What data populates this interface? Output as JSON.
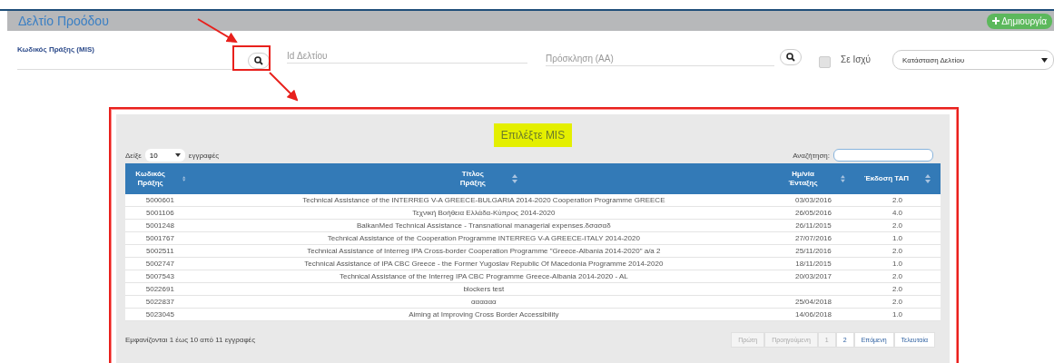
{
  "header": {
    "title": "Δελτίο Προόδου",
    "create_button": "Δημιουργία"
  },
  "filters": {
    "mis_label": "Κωδικός Πράξης (MIS)",
    "id_placeholder": "Id Δελτίου",
    "call_placeholder": "Πρόσκληση (ΑΑ)",
    "in_force": {
      "label": "Σε Ισχύ",
      "checked": false
    },
    "status_select": "Κατάσταση Δελτίου"
  },
  "dialog": {
    "title": "Επιλέξτε MIS",
    "length_prefix": "Δείξε",
    "length_value": "10",
    "length_suffix": "εγγραφές",
    "search_label": "Αναζήτηση:",
    "columns": [
      {
        "label": "Κωδικός Πράξης",
        "sortable": true
      },
      {
        "label": "Τίτλος Πράξης",
        "sortable": true
      },
      {
        "label": "Ημ/νία Ένταξης",
        "sortable": true
      },
      {
        "label": "Έκδοση ΤΑΠ",
        "sortable": true
      }
    ],
    "rows": [
      [
        "5000601",
        "Technical Assistance of the INTERREG V-A GREECE-BULGARIA 2014-2020 Cooperation Programme GREECE",
        "03/03/2016",
        "2.0"
      ],
      [
        "5001106",
        "Τεχνική Βοήθεια Ελλάδα-Κύπρος 2014-2020",
        "26/05/2016",
        "4.0"
      ],
      [
        "5001248",
        "BalkanMed Technical Assistance - Transnational managerial expenses.δσασαδ",
        "26/11/2015",
        "2.0"
      ],
      [
        "5001767",
        "Technical Assistance of the Cooperation Programme INTERREG V-A GREECE-ITALY 2014-2020",
        "27/07/2016",
        "1.0"
      ],
      [
        "5002511",
        "Technical Assistance of Interreg IPA Cross-border Cooperation Programme \"Greece-Albania 2014-2020\" a/a 2",
        "25/11/2016",
        "2.0"
      ],
      [
        "5002747",
        "Technical Assistance of IPA CBC Greece - the Former Yugoslav Republic Of Macedonia Programme 2014-2020",
        "18/11/2015",
        "1.0"
      ],
      [
        "5007543",
        "Technical Assistance of the Interreg IPA CBC Programme Greece-Albania 2014-2020 - AL",
        "20/03/2017",
        "2.0"
      ],
      [
        "5022691",
        "blockers test",
        "",
        "2.0"
      ],
      [
        "5022837",
        "αααααα",
        "25/04/2018",
        "2.0"
      ],
      [
        "5023045",
        "Aiming at Improving Cross Border Accessibility",
        "14/06/2018",
        "1.0"
      ]
    ],
    "info": "Εμφανίζονται 1 έως 10 από 11 εγγραφές",
    "pages": [
      {
        "label": "Πρώτη",
        "disabled": true
      },
      {
        "label": "Προηγούμενη",
        "disabled": true
      },
      {
        "label": "1",
        "disabled": true
      },
      {
        "label": "2",
        "disabled": false
      },
      {
        "label": "Επόμενη",
        "disabled": false
      },
      {
        "label": "Τελευταία",
        "disabled": false
      }
    ]
  }
}
